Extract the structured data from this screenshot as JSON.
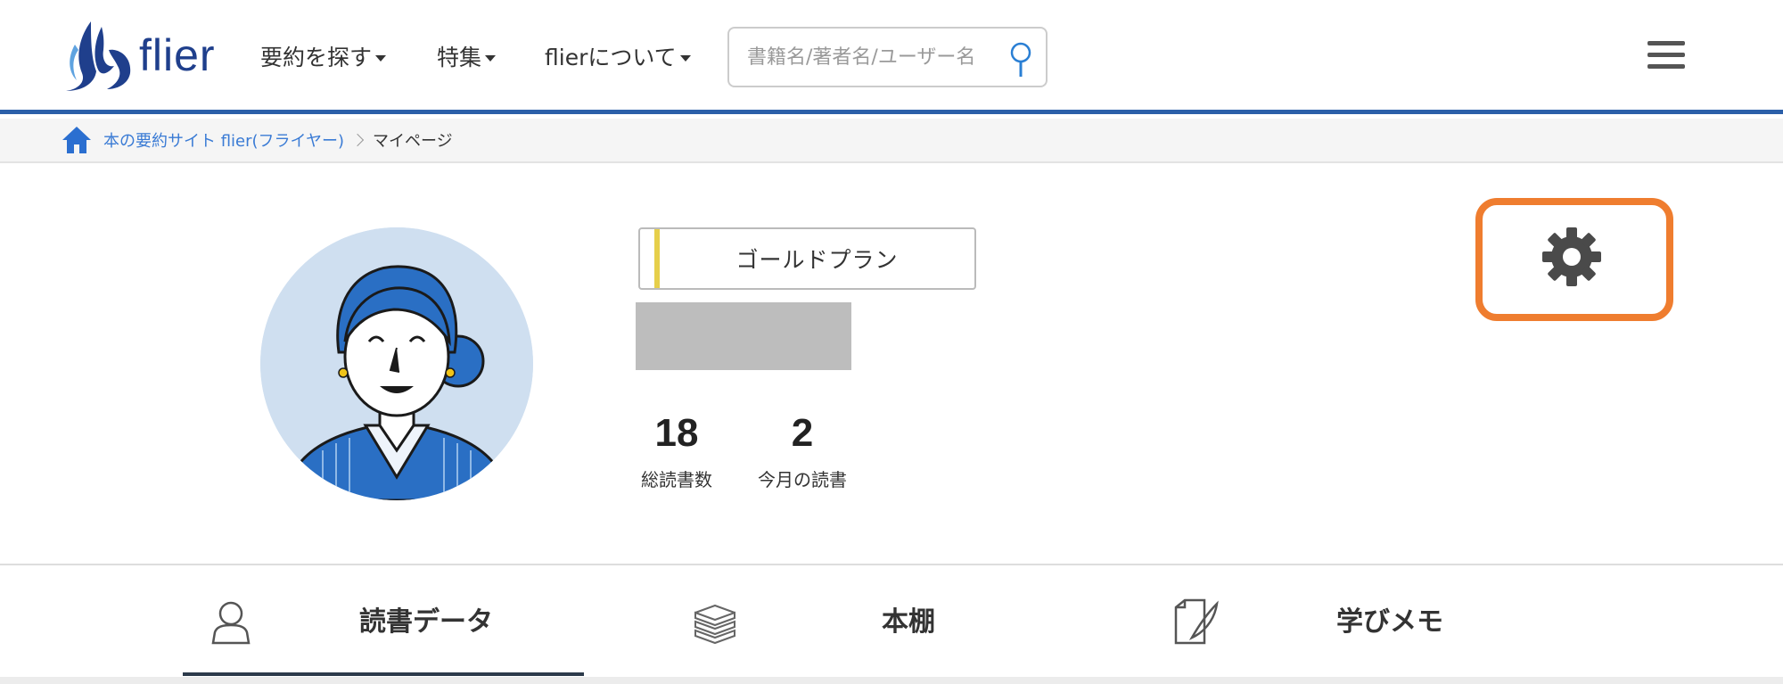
{
  "header": {
    "logo_text": "flier",
    "nav": [
      {
        "label": "要約を探す"
      },
      {
        "label": "特集"
      },
      {
        "label": "flierについて"
      }
    ],
    "search": {
      "placeholder": "書籍名/著者名/ユーザー名"
    }
  },
  "breadcrumb": {
    "home_link": "本の要約サイト flier(フライヤー)",
    "current": "マイページ"
  },
  "profile": {
    "plan": "ゴールドプラン",
    "stats": [
      {
        "value": "18",
        "label": "総読書数"
      },
      {
        "value": "2",
        "label": "今月の読書"
      }
    ]
  },
  "tabs": [
    {
      "label": "読書データ",
      "icon": "person-icon",
      "active": true
    },
    {
      "label": "本棚",
      "icon": "book-stack-icon",
      "active": false
    },
    {
      "label": "学びメモ",
      "icon": "memo-quill-icon",
      "active": false
    }
  ],
  "colors": {
    "brand": "#1f3f8c",
    "header_border": "#2b5fa8",
    "link": "#3a7bd5",
    "highlight": "#ef7d2f",
    "gold": "#e6cf4a"
  }
}
